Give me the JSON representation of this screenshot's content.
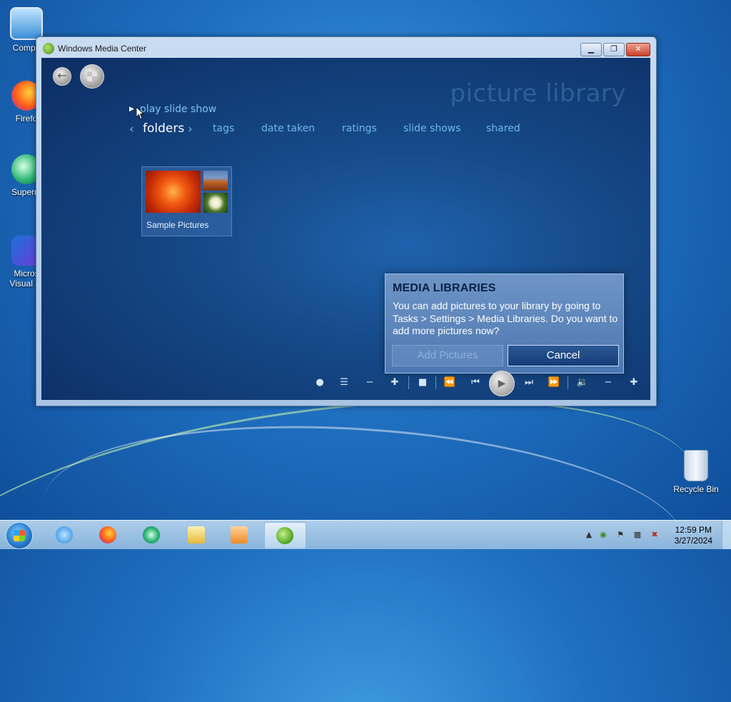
{
  "desktop": {
    "icons": [
      {
        "label": "Compu",
        "icon": "computer-icon"
      },
      {
        "label": "Firefo",
        "icon": "firefox-icon"
      },
      {
        "label": "Superm",
        "icon": "supermium-icon"
      },
      {
        "label": "Micros\nVisual St",
        "icon": "visual-studio-icon"
      },
      {
        "label": "Recycle Bin",
        "icon": "recycle-bin-icon"
      }
    ]
  },
  "window": {
    "title": "Windows Media Center",
    "controls": {
      "minimize": "▁",
      "maximize": "❐",
      "close": "✕"
    }
  },
  "media_center": {
    "page_title": "picture library",
    "play_slide_show": "play slide show",
    "tabs": [
      {
        "label": "folders",
        "active": true
      },
      {
        "label": "tags"
      },
      {
        "label": "date taken"
      },
      {
        "label": "ratings"
      },
      {
        "label": "slide shows"
      },
      {
        "label": "shared"
      }
    ],
    "folder": {
      "label": "Sample Pictures"
    },
    "dialog": {
      "title": "MEDIA LIBRARIES",
      "body": "You can add pictures to your library by going to Tasks > Settings > Media Libraries. Do you want to add more pictures now?",
      "add_button": "Add Pictures",
      "cancel_button": "Cancel"
    }
  },
  "taskbar": {
    "items": [
      {
        "name": "internet-explorer-icon",
        "color": "#1e88e5"
      },
      {
        "name": "firefox-icon",
        "color": "#ff7a1a"
      },
      {
        "name": "supermium-icon",
        "color": "#2bb673"
      },
      {
        "name": "file-explorer-icon",
        "color": "#f2c94c"
      },
      {
        "name": "media-player-icon",
        "color": "#f08a24"
      },
      {
        "name": "media-center-icon",
        "color": "#5cae2e",
        "active": true
      }
    ],
    "clock_time": "12:59 PM",
    "clock_date": "3/27/2024"
  }
}
